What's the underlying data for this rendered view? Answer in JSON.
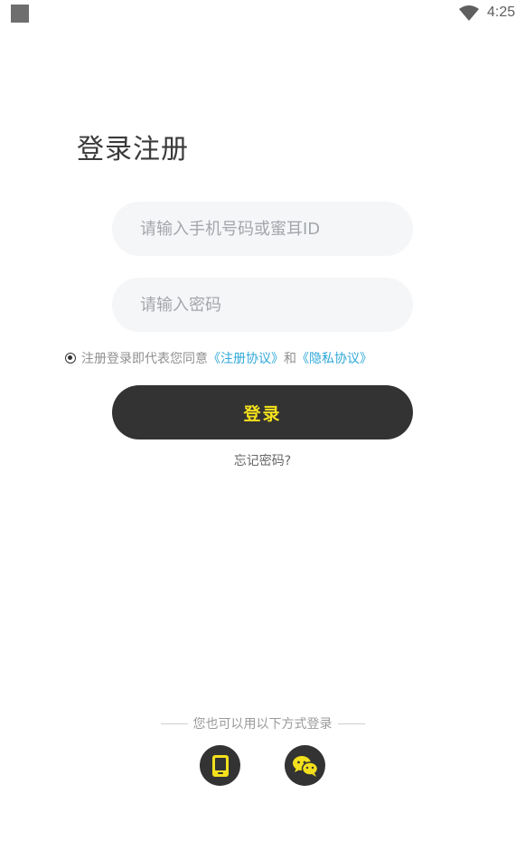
{
  "status_bar": {
    "time": "4:25"
  },
  "page": {
    "title": "登录注册"
  },
  "form": {
    "phone_placeholder": "请输入手机号码或蜜耳ID",
    "password_placeholder": "请输入密码",
    "agreement_prefix": "注册登录即代表您同意",
    "terms_link": "《注册协议》",
    "agreement_and": "和",
    "privacy_link": "《隐私协议》",
    "login_label": "登录",
    "forgot_label": "忘记密码?"
  },
  "alt_login": {
    "label": "您也可以用以下方式登录",
    "icons": [
      "phone-icon",
      "wechat-icon"
    ]
  },
  "colors": {
    "accent": "#f3e01c",
    "dark": "#333333",
    "link": "#2fa7d8",
    "input_bg": "#f5f6f8"
  }
}
